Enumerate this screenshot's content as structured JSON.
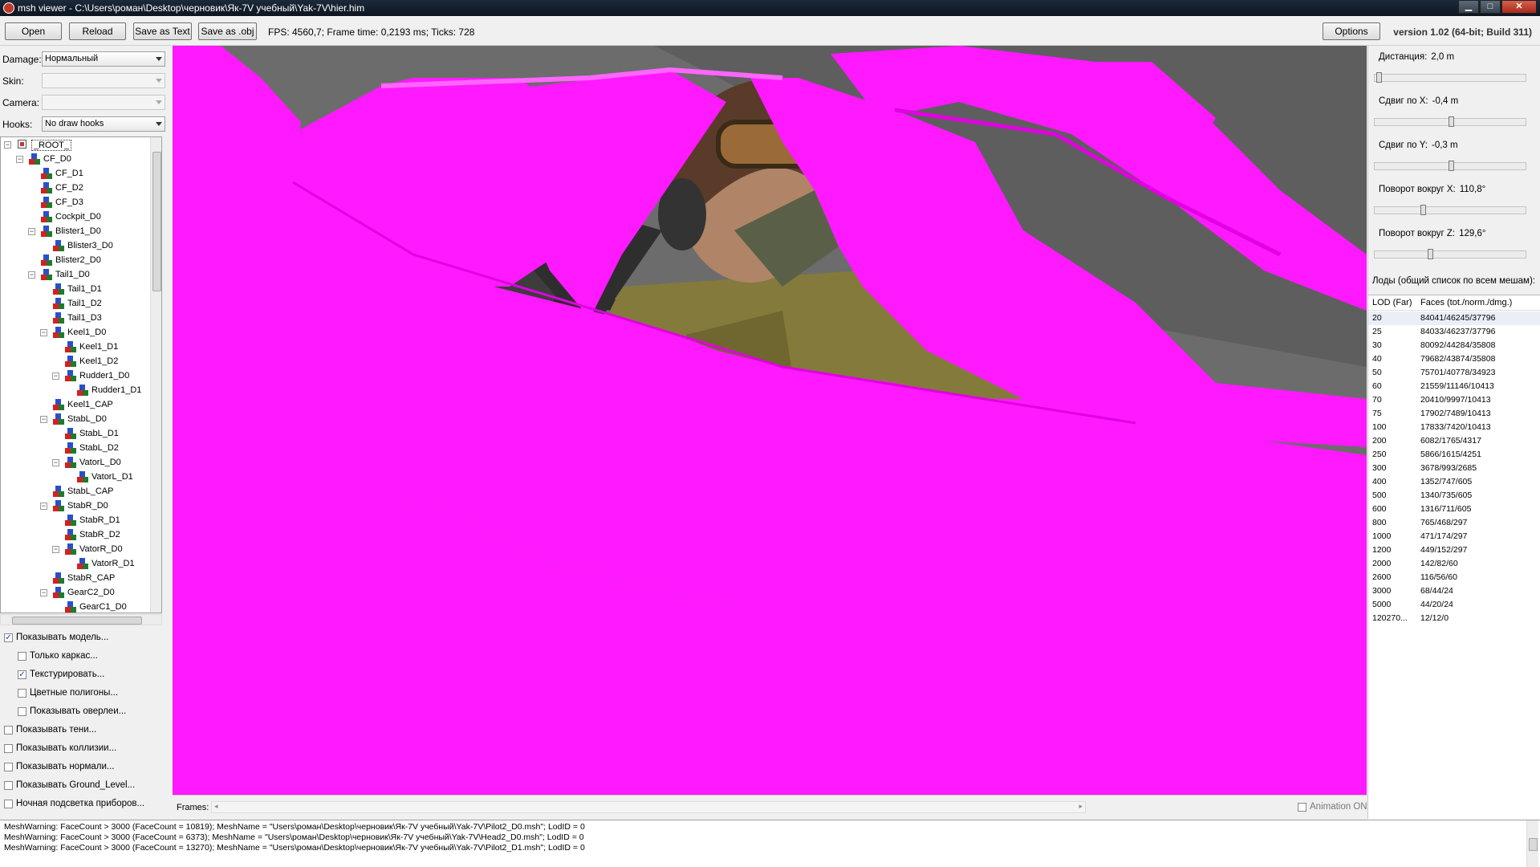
{
  "window": {
    "title": "msh viewer - C:\\Users\\роман\\Desktop\\черновик\\Як-7V учебный\\Yak-7V\\hier.him",
    "minimize": "▁",
    "maximize": "□",
    "close": "✕"
  },
  "toolbar": {
    "open": "Open",
    "reload": "Reload",
    "save_text": "Save as Text",
    "save_obj": "Save as .obj",
    "fps": "FPS: 4560,7; Frame time: 0,2193 ms; Ticks: 728",
    "options": "Options",
    "version": "version 1.02 (64-bit; Build 311)"
  },
  "left": {
    "damage_label": "Damage:",
    "damage_value": "Нормальный",
    "skin_label": "Skin:",
    "skin_value": "",
    "camera_label": "Camera:",
    "camera_value": "",
    "hooks_label": "Hooks:",
    "hooks_value": "No draw hooks"
  },
  "tree": [
    {
      "label": "_ROOT_",
      "level": 0,
      "expander": "−",
      "root": true
    },
    {
      "label": "CF_D0",
      "level": 1,
      "expander": "−"
    },
    {
      "label": "CF_D1",
      "level": 2
    },
    {
      "label": "CF_D2",
      "level": 2
    },
    {
      "label": "CF_D3",
      "level": 2
    },
    {
      "label": "Cockpit_D0",
      "level": 2
    },
    {
      "label": "Blister1_D0",
      "level": 2,
      "expander": "−"
    },
    {
      "label": "Blister3_D0",
      "level": 3
    },
    {
      "label": "Blister2_D0",
      "level": 2
    },
    {
      "label": "Tail1_D0",
      "level": 2,
      "expander": "−"
    },
    {
      "label": "Tail1_D1",
      "level": 3
    },
    {
      "label": "Tail1_D2",
      "level": 3
    },
    {
      "label": "Tail1_D3",
      "level": 3
    },
    {
      "label": "Keel1_D0",
      "level": 3,
      "expander": "−"
    },
    {
      "label": "Keel1_D1",
      "level": 4
    },
    {
      "label": "Keel1_D2",
      "level": 4
    },
    {
      "label": "Rudder1_D0",
      "level": 4,
      "expander": "−"
    },
    {
      "label": "Rudder1_D1",
      "level": 5
    },
    {
      "label": "Keel1_CAP",
      "level": 3
    },
    {
      "label": "StabL_D0",
      "level": 3,
      "expander": "−"
    },
    {
      "label": "StabL_D1",
      "level": 4
    },
    {
      "label": "StabL_D2",
      "level": 4
    },
    {
      "label": "VatorL_D0",
      "level": 4,
      "expander": "−"
    },
    {
      "label": "VatorL_D1",
      "level": 5
    },
    {
      "label": "StabL_CAP",
      "level": 3
    },
    {
      "label": "StabR_D0",
      "level": 3,
      "expander": "−"
    },
    {
      "label": "StabR_D1",
      "level": 4
    },
    {
      "label": "StabR_D2",
      "level": 4
    },
    {
      "label": "VatorR_D0",
      "level": 4,
      "expander": "−"
    },
    {
      "label": "VatorR_D1",
      "level": 5
    },
    {
      "label": "StabR_CAP",
      "level": 3
    },
    {
      "label": "GearC2_D0",
      "level": 3,
      "expander": "−"
    },
    {
      "label": "GearC1_D0",
      "level": 4
    }
  ],
  "checkboxes": [
    {
      "label": "Показывать модель...",
      "checked": true,
      "indent": 0
    },
    {
      "label": "Только каркас...",
      "checked": false,
      "indent": 1
    },
    {
      "label": "Текстурировать...",
      "checked": true,
      "indent": 1
    },
    {
      "label": "Цветные полигоны...",
      "checked": false,
      "indent": 1
    },
    {
      "label": "Показывать оверлеи...",
      "checked": false,
      "indent": 1
    },
    {
      "label": "Показывать тени...",
      "checked": false,
      "indent": 0
    },
    {
      "label": "Показывать коллизии...",
      "checked": false,
      "indent": 0
    },
    {
      "label": "Показывать нормали...",
      "checked": false,
      "indent": 0
    },
    {
      "label": "Показывать Ground_Level...",
      "checked": false,
      "indent": 0
    },
    {
      "label": "Ночная подсветка приборов...",
      "checked": false,
      "indent": 0
    }
  ],
  "checkmark": "✓",
  "right": {
    "sliders": [
      {
        "label": "Дистанция:",
        "value": "2,0 m",
        "fraction": 0.01
      },
      {
        "label": "Сдвиг по X:",
        "value": "-0,4 m",
        "fraction": 0.5
      },
      {
        "label": "Сдвиг по Y:",
        "value": "-0,3 m",
        "fraction": 0.5
      },
      {
        "label": "Поворот вокруг X:",
        "value": "110,8°",
        "fraction": 0.31
      },
      {
        "label": "Поворот вокруг Z:",
        "value": "129,6°",
        "fraction": 0.36
      }
    ],
    "lods_title": "Лоды (общий список по всем мешам):",
    "lod_col": "LOD (Far)",
    "faces_col": "Faces (tot./norm./dmg.)",
    "lods": [
      {
        "lod": "20",
        "faces": "84041/46245/37796"
      },
      {
        "lod": "25",
        "faces": "84033/46237/37796"
      },
      {
        "lod": "30",
        "faces": "80092/44284/35808"
      },
      {
        "lod": "40",
        "faces": "79682/43874/35808"
      },
      {
        "lod": "50",
        "faces": "75701/40778/34923"
      },
      {
        "lod": "60",
        "faces": "21559/11146/10413"
      },
      {
        "lod": "70",
        "faces": "20410/9997/10413"
      },
      {
        "lod": "75",
        "faces": "17902/7489/10413"
      },
      {
        "lod": "100",
        "faces": "17833/7420/10413"
      },
      {
        "lod": "200",
        "faces": "6082/1765/4317"
      },
      {
        "lod": "250",
        "faces": "5866/1615/4251"
      },
      {
        "lod": "300",
        "faces": "3678/993/2685"
      },
      {
        "lod": "400",
        "faces": "1352/747/605"
      },
      {
        "lod": "500",
        "faces": "1340/735/605"
      },
      {
        "lod": "600",
        "faces": "1316/711/605"
      },
      {
        "lod": "800",
        "faces": "765/468/297"
      },
      {
        "lod": "1000",
        "faces": "471/174/297"
      },
      {
        "lod": "1200",
        "faces": "449/152/297"
      },
      {
        "lod": "2000",
        "faces": "142/82/60"
      },
      {
        "lod": "2600",
        "faces": "116/56/60"
      },
      {
        "lod": "3000",
        "faces": "68/44/24"
      },
      {
        "lod": "5000",
        "faces": "44/20/24"
      },
      {
        "lod": "120270...",
        "faces": "12/12/0"
      }
    ]
  },
  "frames": {
    "label": "Frames:",
    "animation": "Animation ON"
  },
  "log": [
    "MeshWarning: FaceCount > 3000 (FaceCount = 10819); MeshName = \"Users\\роман\\Desktop\\черновик\\Як-7V учебный\\Yak-7V\\Pilot2_D0.msh\"; LodID = 0",
    "MeshWarning: FaceCount > 3000 (FaceCount = 6373); MeshName = \"Users\\роман\\Desktop\\черновик\\Як-7V учебный\\Yak-7V\\Head2_D0.msh\"; LodID = 0",
    "MeshWarning: FaceCount > 3000 (FaceCount = 13270); MeshName = \"Users\\роман\\Desktop\\черновик\\Як-7V учебный\\Yak-7V\\Pilot2_D1.msh\"; LodID = 0"
  ],
  "colors": {
    "magenta": "#ff19ff",
    "viewport_bg": "#6c6c6c",
    "uniform": "#847a3c",
    "helmet": "#5a3a28"
  }
}
